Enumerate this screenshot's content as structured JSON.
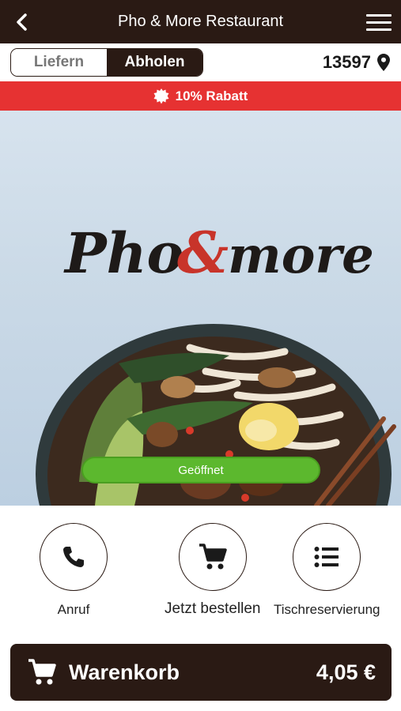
{
  "header": {
    "title": "Pho & More Restaurant",
    "back_icon": "chevron-left-icon",
    "menu_icon": "hamburger-menu-icon"
  },
  "order_mode": {
    "options": [
      "Liefern",
      "Abholen"
    ],
    "selected": "Abholen"
  },
  "location": {
    "zip": "13597",
    "icon": "map-pin-icon"
  },
  "promo": {
    "text": "10% Rabatt",
    "icon": "badge-icon"
  },
  "hero": {
    "logo_text_left": "Pho",
    "logo_ampersand": "&",
    "logo_text_right": "more",
    "status": "Geöffnet"
  },
  "actions": [
    {
      "label": "Anruf",
      "icon": "phone-icon"
    },
    {
      "label": "Jetzt bestellen",
      "icon": "cart-icon"
    },
    {
      "label": "Tischreservierung",
      "icon": "list-icon"
    }
  ],
  "cart": {
    "label": "Warenkorb",
    "total": "4,05 €",
    "icon": "cart-icon"
  },
  "colors": {
    "primary_dark": "#2a1a14",
    "promo_red": "#e63232",
    "open_green": "#5cb82e",
    "logo_red": "#c8342a"
  }
}
